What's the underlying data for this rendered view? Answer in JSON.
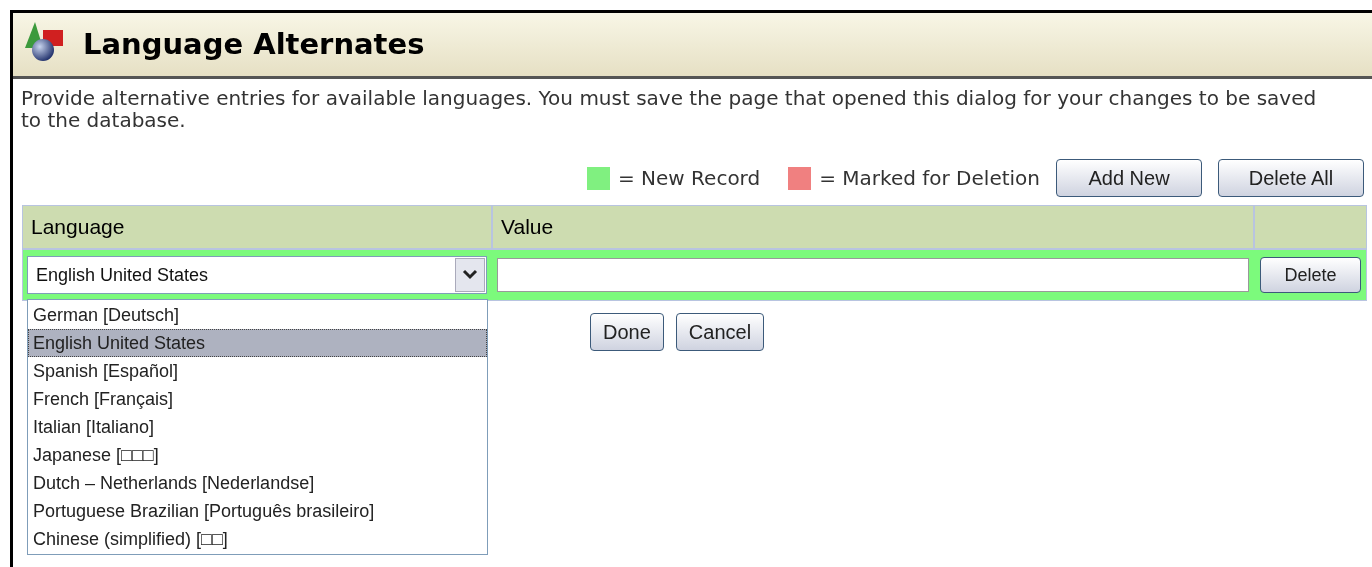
{
  "header": {
    "title": "Language Alternates"
  },
  "description": "Provide alternative entries for available languages. You must save the page that opened this dialog for your changes to be saved to the database.",
  "legend": [
    {
      "label": "= New Record",
      "color": "#80f080"
    },
    {
      "label": "= Marked for Deletion",
      "color": "#f08080"
    }
  ],
  "toolbar_buttons": [
    "Add New",
    "Delete All"
  ],
  "table": {
    "columns": [
      "Language",
      "Value"
    ],
    "rows": [
      {
        "language": "English United States",
        "value": "",
        "button": "Delete",
        "new_record": true
      }
    ]
  },
  "dropdown": {
    "expanded": true,
    "options": [
      {
        "label": "German [Deutsch]",
        "selected": false
      },
      {
        "label": "English United States",
        "selected": true
      },
      {
        "label": "Spanish [Español]",
        "selected": false
      },
      {
        "label": "French [Français]",
        "selected": false
      },
      {
        "label": "Italian [Italiano]",
        "selected": false
      },
      {
        "label": "Japanese [□□□]",
        "selected": false
      },
      {
        "label": "Dutch – Netherlands [Nederlandse]",
        "selected": false
      },
      {
        "label": "Portuguese Brazilian [Português brasileiro]",
        "selected": false
      },
      {
        "label": "Chinese (simplified) [□□]",
        "selected": false
      }
    ]
  },
  "footer_buttons": [
    "Done",
    "Cancel"
  ]
}
